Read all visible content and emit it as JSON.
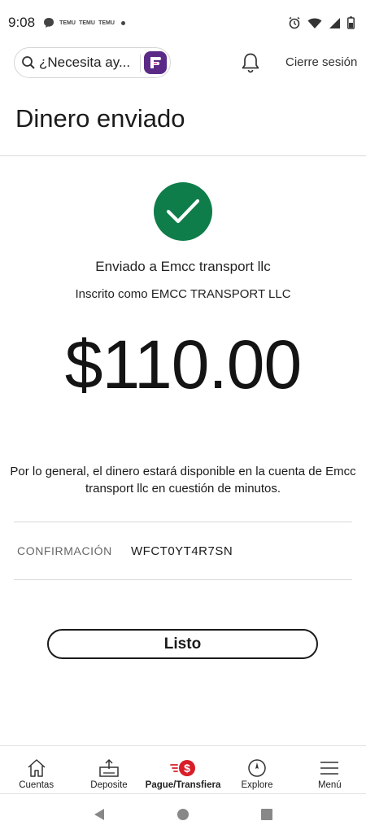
{
  "status_bar": {
    "time": "9:08",
    "notif_badges": [
      "TEMU",
      "TEMU",
      "TEMU"
    ]
  },
  "header": {
    "search_placeholder": "¿Necesita ay...",
    "logout_label": "Cierre sesión"
  },
  "page": {
    "title": "Dinero enviado",
    "sent_to": "Enviado a Emcc transport llc",
    "enrolled_as": "Inscrito como EMCC TRANSPORT LLC",
    "amount": "$110.00",
    "availability_note": "Por lo general, el dinero estará disponible en la cuenta de Emcc transport llc en cuestión de minutos.",
    "confirmation_label": "CONFIRMACIÓN",
    "confirmation_value": "WFCT0YT4R7SN",
    "done_button": "Listo"
  },
  "bottom_nav": [
    {
      "label": "Cuentas",
      "icon": "home-icon"
    },
    {
      "label": "Deposite",
      "icon": "deposit-icon"
    },
    {
      "label": "Pague/Transfiera",
      "icon": "pay-transfer-icon",
      "active": true
    },
    {
      "label": "Explore",
      "icon": "compass-icon"
    },
    {
      "label": "Menú",
      "icon": "hamburger-icon"
    }
  ],
  "colors": {
    "success_green": "#0f7d4a",
    "brand_red": "#d71e28",
    "assistant_purple": "#5b2a86"
  }
}
